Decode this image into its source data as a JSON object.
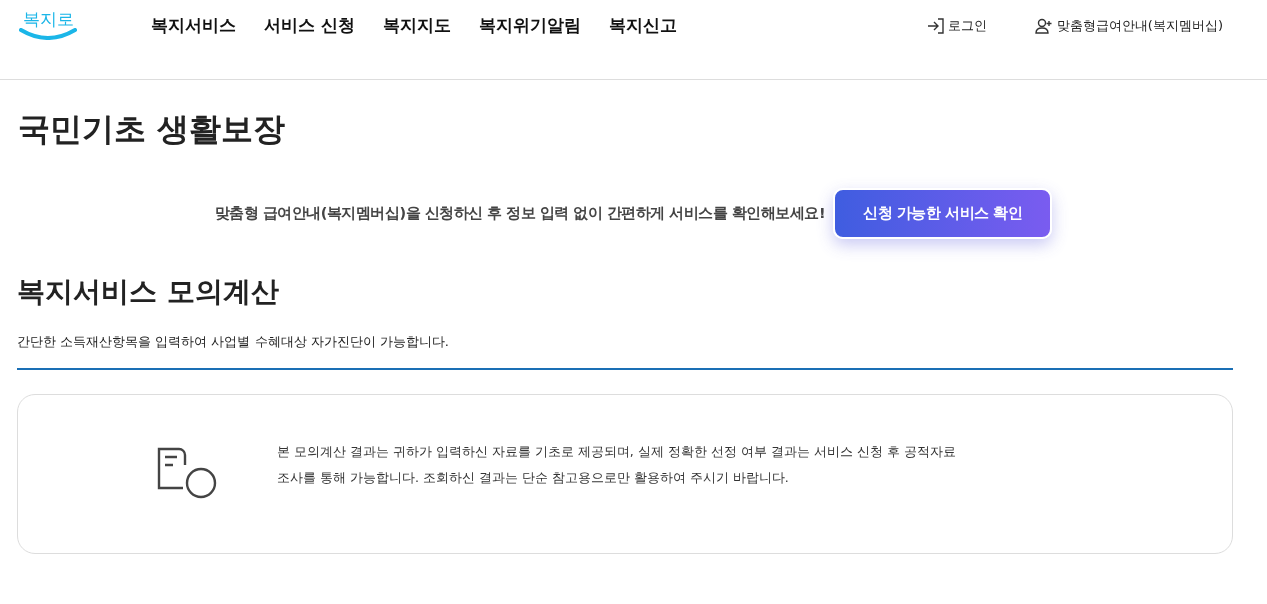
{
  "header": {
    "logo": "복지로",
    "nav": [
      "복지서비스",
      "서비스 신청",
      "복지지도",
      "복지위기알림",
      "복지신고"
    ],
    "utility": [
      {
        "kind": "login",
        "label": "로그인"
      },
      {
        "kind": "member",
        "label": "맞춤형급여안내(복지멤버십)"
      }
    ]
  },
  "page_title": "국민기초 생활보장",
  "promo": {
    "text": "맞춤형 급여안내(복지멤버십)을 신청하신 후 정보 입력 없이 간편하게 서비스를 확인해보세요!",
    "button": "신청 가능한 서비스 확인"
  },
  "section": {
    "title": "복지서비스 모의계산",
    "description": "간단한 소득재산항목을 입력하여 사업별 수혜대상 자가진단이 가능합니다."
  },
  "notice": {
    "lines": [
      "본 모의계산 결과는 귀하가 입력하신 자료를 기초로 제공되며, 실제 정확한 선정 여부 결과는 서비스 신청 후 공적자료",
      "조사를 통해 가능합니다. 조회하신 결과는 단순 참고용으로만 활용하여 주시기 바랍니다."
    ]
  }
}
